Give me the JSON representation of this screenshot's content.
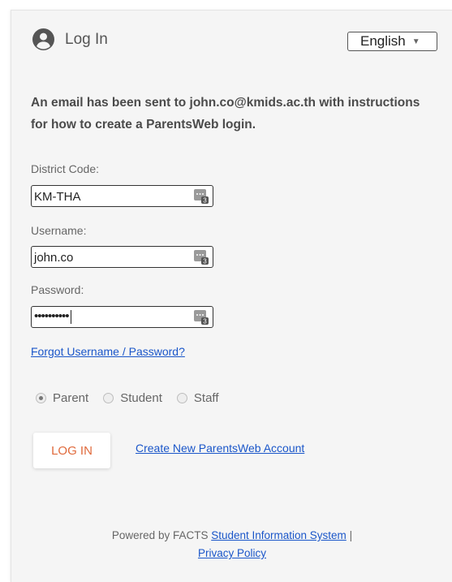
{
  "header": {
    "title": "Log In",
    "user_icon": "user-circle-icon"
  },
  "language": {
    "selected": "English",
    "caret": "▼"
  },
  "message": "An email has been sent to john.co@kmids.ac.th with instructions for how to create a ParentsWeb login.",
  "form": {
    "district": {
      "label": "District Code:",
      "value": "KM-THA"
    },
    "username": {
      "label": "Username:",
      "value": "john.co"
    },
    "password": {
      "label": "Password:",
      "value": "••••••••••"
    },
    "forgot_link": "Forgot Username / Password?"
  },
  "roles": [
    {
      "label": "Parent",
      "selected": true
    },
    {
      "label": "Student",
      "selected": false
    },
    {
      "label": "Staff",
      "selected": false
    }
  ],
  "actions": {
    "login": "LOG IN",
    "create": "Create New ParentsWeb Account"
  },
  "footer": {
    "prefix": "Powered by FACTS ",
    "sis_link": "Student Information System",
    "separator": " |",
    "privacy_link": "Privacy Policy"
  },
  "colors": {
    "accent": "#e06a3c",
    "link": "#1a56c9",
    "panel": "#f5f5f5"
  }
}
